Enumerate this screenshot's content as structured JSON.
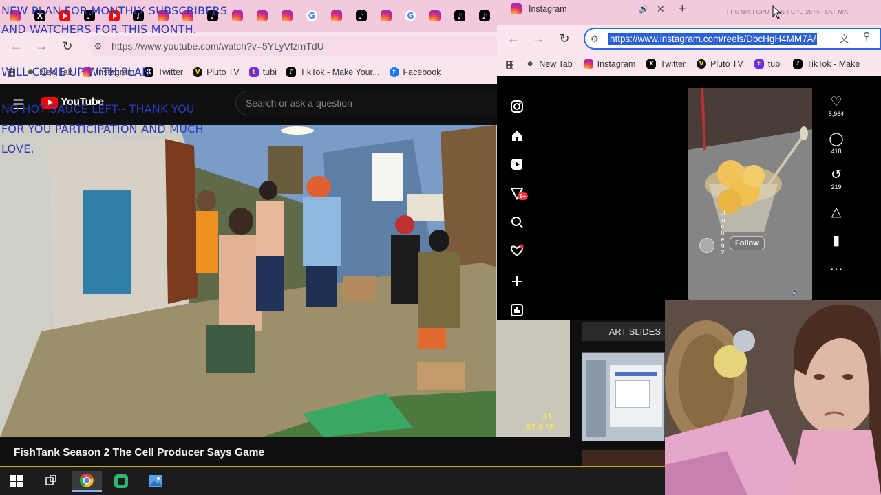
{
  "youtube_window": {
    "url": "https://www.youtube.com/watch?v=5YLyVfzmTdU",
    "bookmarks": [
      {
        "label": "New Tab",
        "icon": "new-tab-icon"
      },
      {
        "label": "Instagram",
        "icon": "instagram-icon"
      },
      {
        "label": "Twitter",
        "icon": "x-icon"
      },
      {
        "label": "Pluto TV",
        "icon": "pluto-tv-icon"
      },
      {
        "label": "tubi",
        "icon": "tubi-icon"
      },
      {
        "label": "TikTok - Make Your...",
        "icon": "tiktok-icon"
      },
      {
        "label": "Facebook",
        "icon": "facebook-icon"
      }
    ],
    "search_placeholder": "Search or ask a question",
    "logo_text": "YouTube",
    "video_title": "FishTank Season 2 The Cell Producer Says Game",
    "temp_line1": "31.",
    "temp_line2": "87.9 °F",
    "sidebar_title": "ART SLIDES"
  },
  "overlay": {
    "plan": "NEW PLAN FOR MONTHLY SUBSCRIBERS AND WATCHERS FOR THIS MONTH.",
    "come_up": "WILL COME UP WITH PLAN",
    "sauce": "NO HOT SAUCE LEFT-- THANK YOU FOR YOU PARTICIPATION AND MUCH LOVE."
  },
  "instagram_window": {
    "tab_title": "Instagram",
    "stats": "FPS N/A  |  GPU 35 %  |  CPU 25 %  |  LAT N/A",
    "url": "https://www.instagram.com/reels/DbcHgH4MM7A/",
    "bookmarks": [
      {
        "label": "New Tab"
      },
      {
        "label": "Instagram"
      },
      {
        "label": "Twitter"
      },
      {
        "label": "Pluto TV"
      },
      {
        "label": "tubi"
      },
      {
        "label": "TikTok - Make"
      }
    ],
    "notification_badge": "9+",
    "reel_username": "blinche92",
    "follow_label": "Follow",
    "likes": "5,964",
    "comments": "418",
    "reposts": "219"
  },
  "colors": {
    "tabstrip_pink": "#f3c9de",
    "overlay_text": "#2a3ab8",
    "url_highlight": "#2a5fd8",
    "youtube_red": "#ff0000"
  }
}
